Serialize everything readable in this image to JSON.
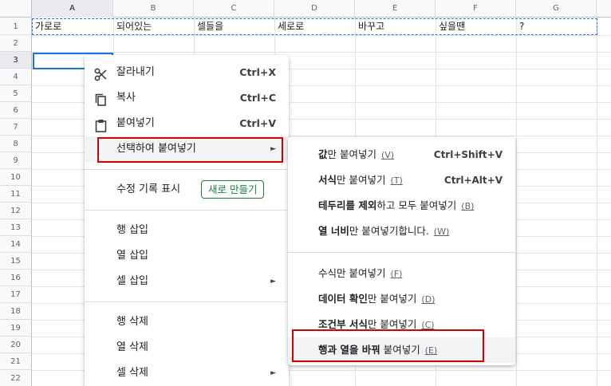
{
  "columns": [
    "A",
    "B",
    "C",
    "D",
    "E",
    "F",
    "G"
  ],
  "rows": [
    "1",
    "2",
    "3",
    "4",
    "5",
    "6",
    "7",
    "8",
    "9",
    "10",
    "11",
    "12",
    "13",
    "14",
    "15",
    "16",
    "17",
    "18",
    "19",
    "20",
    "21",
    "22"
  ],
  "row1_cells": [
    "가로로",
    "되어있는",
    "셀들을",
    "세로로",
    "바꾸고",
    "싶을땐",
    "?"
  ],
  "menu": {
    "cut": {
      "label": "잘라내기",
      "shortcut": "Ctrl+X"
    },
    "copy": {
      "label": "복사",
      "shortcut": "Ctrl+C"
    },
    "paste": {
      "label": "붙여넣기",
      "shortcut": "Ctrl+V"
    },
    "paste_special": {
      "label": "선택하여 붙여넣기",
      "arrow": "►"
    },
    "edit_history": {
      "label": "수정 기록 표시",
      "button": "새로 만들기"
    },
    "insert_row": {
      "label": "행 삽입"
    },
    "insert_col": {
      "label": "열 삽입"
    },
    "insert_cell": {
      "label": "셀 삽입",
      "arrow": "►"
    },
    "delete_row": {
      "label": "행 삭제"
    },
    "delete_col": {
      "label": "열 삭제"
    },
    "delete_cell": {
      "label": "셀 삭제",
      "arrow": "►"
    }
  },
  "submenu": {
    "values": {
      "bold": "값",
      "rest": "만 붙여넣기",
      "key": "(V)",
      "shortcut": "Ctrl+Shift+V"
    },
    "format": {
      "bold": "서식",
      "rest": "만 붙여넣기",
      "key": "(T)",
      "shortcut": "Ctrl+Alt+V"
    },
    "no_borders": {
      "bold": "테두리를 제외",
      "rest": "하고 모두 붙여넣기",
      "key": "(B)"
    },
    "col_width": {
      "bold": "열 너비",
      "rest": "만 붙여넣기합니다.",
      "key": "(W)"
    },
    "formula": {
      "bold": "",
      "rest": "수식만 붙여넣기",
      "key": "(F)"
    },
    "validation": {
      "bold": "데이터 확인",
      "rest": "만 붙여넣기",
      "key": "(D)"
    },
    "conditional": {
      "bold": "조건부 서식",
      "rest": "만 붙여넣기",
      "key": "(C)"
    },
    "transpose": {
      "bold": "행과 열을 바꿔",
      "rest": " 붙여넣기",
      "key": "(E)"
    }
  },
  "colors": {
    "accent": "#1a73e8",
    "highlight": "#d50000",
    "new_button": "#188038"
  }
}
